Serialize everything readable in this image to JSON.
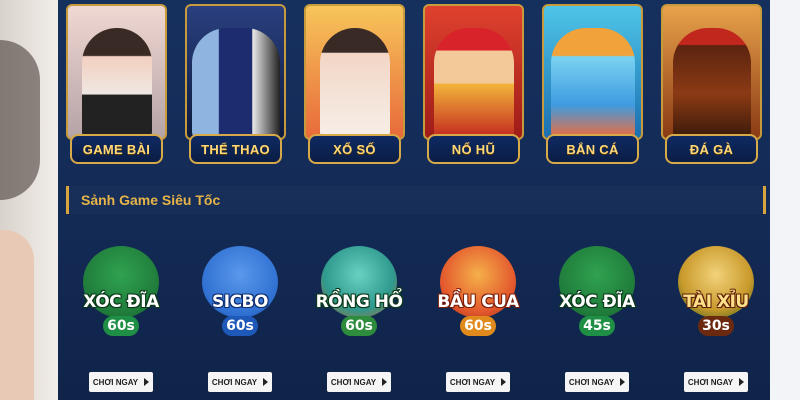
{
  "categories": [
    {
      "label": "GAME BÀI",
      "icon": "card-game-icon",
      "colors": [
        "#f0d7d2",
        "#b5a3a6"
      ]
    },
    {
      "label": "THỂ THAO",
      "icon": "soccer-players-icon",
      "colors": [
        "#2a3f7e",
        "#0d1b3f"
      ]
    },
    {
      "label": "XỔ SỐ",
      "icon": "lottery-balls-icon",
      "colors": [
        "#f7c55a",
        "#e86a3a"
      ]
    },
    {
      "label": "NỔ HŨ",
      "icon": "slot-jackpot-icon",
      "colors": [
        "#e0412e",
        "#9e1c18"
      ]
    },
    {
      "label": "BẮN CÁ",
      "icon": "fish-shooting-icon",
      "colors": [
        "#4fc5e8",
        "#1a6fb0"
      ]
    },
    {
      "label": "ĐÁ GÀ",
      "icon": "rooster-icon",
      "colors": [
        "#e8a24b",
        "#8a3a14"
      ]
    }
  ],
  "section": {
    "title": "Sảnh Game Siêu Tốc"
  },
  "games": [
    {
      "line1": "XÓC ĐĨA",
      "line2": "60s",
      "icon": "xoc-dia-icon",
      "disc": "#1f7a3a",
      "badge": "#1f8f45"
    },
    {
      "line1": "SICBO",
      "line2": "60s",
      "icon": "dice-icon",
      "disc": "#2e6fd1",
      "badge": "#1e58b8"
    },
    {
      "line1": "RỒNG HỔ",
      "line2": "60s",
      "icon": "dragon-tiger-icon",
      "disc": "#2f9a8e",
      "badge": "#2d8d3c"
    },
    {
      "line1": "BẦU CUA",
      "line2": "60s",
      "icon": "bau-cua-icon",
      "disc": "#e3572d",
      "badge": "#e08a1e"
    },
    {
      "line1": "XÓC ĐĨA",
      "line2": "45s",
      "icon": "xoc-dia-icon",
      "disc": "#1f7a3a",
      "badge": "#1f8f45"
    },
    {
      "line1": "TÀI XỈU",
      "line2": "30s",
      "icon": "tai-xiu-icon",
      "disc": "#c99a2c",
      "badge": "#6b2a0f"
    }
  ],
  "play_label": "CHƠI NGAY"
}
